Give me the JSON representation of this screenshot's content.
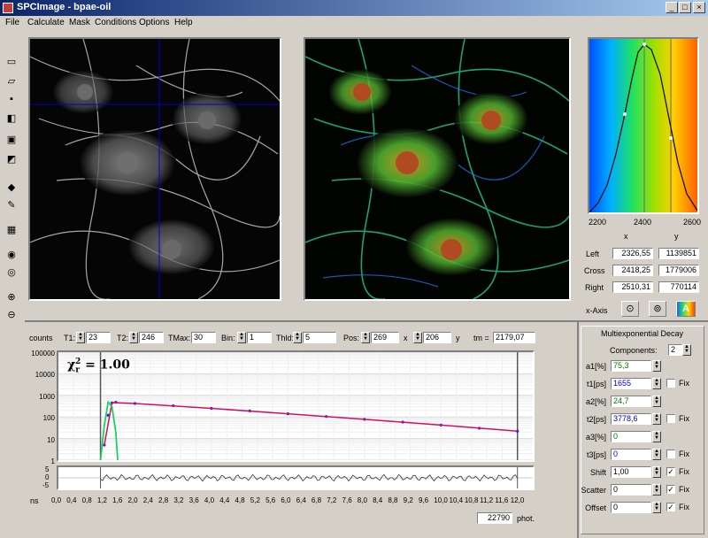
{
  "window": {
    "title": "SPCImage - bpae-oil",
    "min_glyph": "_",
    "max_glyph": "□",
    "close_glyph": "×"
  },
  "menu": [
    "File",
    "Calculate",
    "Mask",
    "Conditions",
    "Options",
    "Help"
  ],
  "toolbar": {
    "icons": [
      "new-file-icon",
      "open-icon",
      "save-icon",
      "copy-icon",
      "lock-icon",
      "unlock-icon",
      "diamond-icon",
      "brush-icon",
      "color-map-icon",
      "camera-icon",
      "export-icon",
      "zoom-in-icon",
      "zoom-out-icon"
    ],
    "glyphs": [
      "▭",
      "▱",
      "▪",
      "◧",
      "▣",
      "◩",
      "◆",
      "✎",
      "▦",
      "◉",
      "◎",
      "⊕",
      "⊖"
    ]
  },
  "histogram": {
    "x_ticks": [
      "2200",
      "2400",
      "2600"
    ],
    "col_x": "x",
    "col_y": "y",
    "rows": [
      {
        "label": "Left",
        "x": "2326,55",
        "y": "1139851"
      },
      {
        "label": "Cross",
        "x": "2418,25",
        "y": "1779006"
      },
      {
        "label": "Right",
        "x": "2510,31",
        "y": "770114"
      }
    ],
    "xaxis_label": "x-Axis"
  },
  "params": {
    "counts_label": "counts",
    "t1_label": "T1:",
    "t1": "23",
    "t2_label": "T2:",
    "t2": "246",
    "tmax_label": "TMax:",
    "tmax": "30",
    "bin_label": "Bin:",
    "bin": "1",
    "thld_label": "Thld:",
    "thld": "5",
    "pos_label": "Pos:",
    "pos_x": "269",
    "pos_x_label": "x",
    "pos_y": "206",
    "pos_y_label": "y",
    "tm_label": "tm =",
    "tm": "2179,07"
  },
  "decay_plot": {
    "chi_label": "χ",
    "chi_sub": "r",
    "chi_sup": "2",
    "chi_value": "= 1.00",
    "y_ticks": [
      "100000",
      "10000",
      "1000",
      "100",
      "10",
      "1"
    ],
    "res_ticks": [
      "5",
      "0",
      "-5"
    ],
    "x_unit": "ns",
    "x_ticks": [
      "0,0",
      "0,4",
      "0,8",
      "1,2",
      "1,6",
      "2,0",
      "2,4",
      "2,8",
      "3,2",
      "3,6",
      "4,0",
      "4,4",
      "4,8",
      "5,2",
      "5,6",
      "6,0",
      "6,4",
      "6,8",
      "7,2",
      "7,6",
      "8,0",
      "8,4",
      "8,8",
      "9,2",
      "9,6",
      "10,0",
      "10,4",
      "10,8",
      "11,2",
      "11,6",
      "12,0"
    ],
    "phot_value": "22790",
    "phot_label": "phot."
  },
  "chart_data": {
    "type": "scatter",
    "title": "",
    "xlabel": "ns",
    "ylabel": "",
    "xlim": [
      0,
      12.4
    ],
    "ylim": [
      1,
      100000
    ],
    "yscale": "log",
    "series": [
      {
        "values": [
          [
            1.2,
            5
          ],
          [
            1.3,
            120
          ],
          [
            1.4,
            450
          ],
          [
            1.5,
            480
          ],
          [
            2,
            420
          ],
          [
            3,
            330
          ],
          [
            4,
            250
          ],
          [
            5,
            190
          ],
          [
            6,
            140
          ],
          [
            7,
            105
          ],
          [
            8,
            78
          ],
          [
            9,
            58
          ],
          [
            10,
            42
          ],
          [
            11,
            30
          ],
          [
            12,
            22
          ]
        ]
      },
      {
        "values": [
          [
            1.2,
            5
          ],
          [
            1.4,
            460
          ],
          [
            2,
            420
          ],
          [
            4,
            250
          ],
          [
            6,
            140
          ],
          [
            8,
            78
          ],
          [
            10,
            42
          ],
          [
            12,
            22
          ]
        ]
      },
      {
        "values": [
          [
            1.1,
            1
          ],
          [
            1.2,
            40
          ],
          [
            1.3,
            480
          ],
          [
            1.4,
            300
          ],
          [
            1.5,
            20
          ],
          [
            1.55,
            1
          ]
        ]
      }
    ]
  },
  "decay_fit": {
    "title": "Multiexponential Decay",
    "components_label": "Components:",
    "components": "2",
    "rows": [
      {
        "label": "a1[%]",
        "value": "75,3",
        "color": "#007a00",
        "fix": false,
        "has_fix": false
      },
      {
        "label": "t1[ps]",
        "value": "1655",
        "color": "#0000c0",
        "fix": false,
        "has_fix": true
      },
      {
        "label": "a2[%]",
        "value": "24,7",
        "color": "#007a00",
        "fix": false,
        "has_fix": false
      },
      {
        "label": "t2[ps]",
        "value": "3778,6",
        "color": "#0000c0",
        "fix": false,
        "has_fix": true
      },
      {
        "label": "a3[%]",
        "value": "0",
        "color": "#007a00",
        "fix": false,
        "has_fix": false
      },
      {
        "label": "t3[ps]",
        "value": "0",
        "color": "#0000c0",
        "fix": false,
        "has_fix": true
      },
      {
        "label": "Shift",
        "value": "1,00",
        "color": "#000000",
        "fix": true,
        "has_fix": true
      },
      {
        "label": "Scatter",
        "value": "0",
        "color": "#000000",
        "fix": true,
        "has_fix": true
      },
      {
        "label": "Offset",
        "value": "0",
        "color": "#000000",
        "fix": true,
        "has_fix": true
      }
    ],
    "fix_label": "Fix",
    "check_glyph": "✓"
  },
  "colors": {
    "titlebar_start": "#0a246a",
    "fit_curve": "#d01060",
    "data_points": "#2020ff",
    "irf_curve": "#20d060",
    "cursor_line": "#0000cc"
  }
}
